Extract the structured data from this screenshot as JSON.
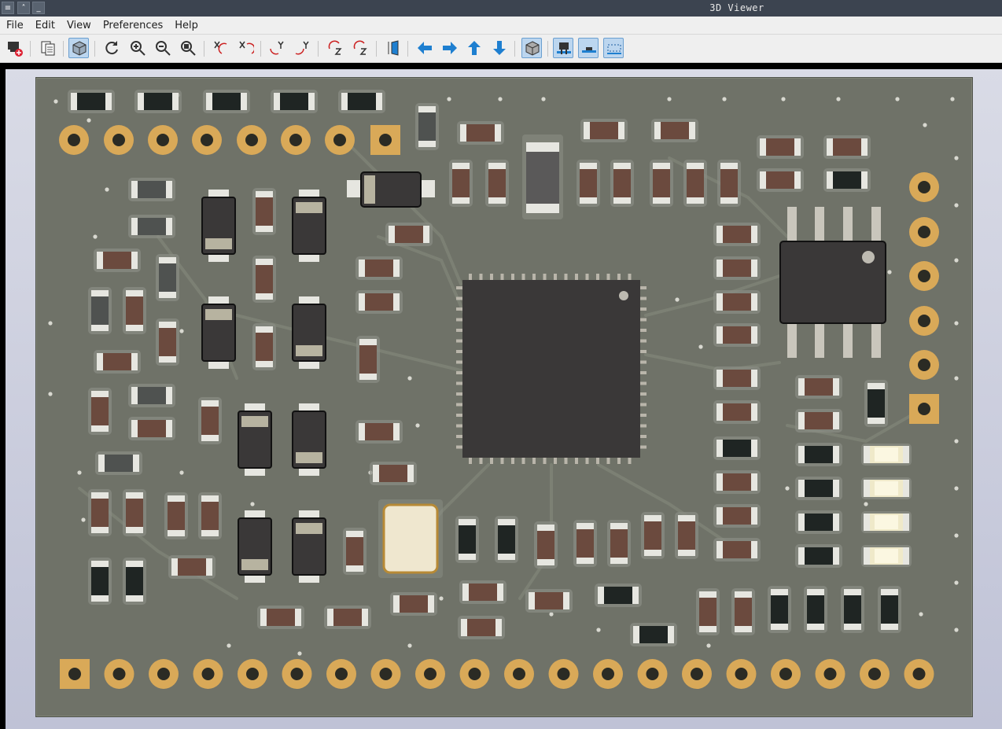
{
  "window": {
    "title": "3D Viewer"
  },
  "menu": [
    "File",
    "Edit",
    "View",
    "Preferences",
    "Help"
  ],
  "toolbar": [
    {
      "name": "export-icon",
      "tip": "Export"
    },
    {
      "name": "copy-icon",
      "tip": "Copy"
    },
    {
      "name": "view-3d-icon",
      "tip": "3D view",
      "active": true
    },
    {
      "name": "refresh-icon",
      "tip": "Reload"
    },
    {
      "name": "zoom-in-icon",
      "tip": "Zoom in"
    },
    {
      "name": "zoom-out-icon",
      "tip": "Zoom out"
    },
    {
      "name": "zoom-fit-icon",
      "tip": "Zoom to fit"
    },
    {
      "name": "rotate-x-cw-icon",
      "tip": "Rotate X clockwise"
    },
    {
      "name": "rotate-x-ccw-icon",
      "tip": "Rotate X counterclockwise"
    },
    {
      "name": "rotate-y-cw-icon",
      "tip": "Rotate Y clockwise"
    },
    {
      "name": "rotate-y-ccw-icon",
      "tip": "Rotate Y counterclockwise"
    },
    {
      "name": "rotate-z-cw-icon",
      "tip": "Rotate Z clockwise"
    },
    {
      "name": "rotate-z-ccw-icon",
      "tip": "Rotate Z counterclockwise"
    },
    {
      "name": "flip-board-icon",
      "tip": "Flip board"
    },
    {
      "name": "pan-left-icon",
      "tip": "Pan left"
    },
    {
      "name": "pan-right-icon",
      "tip": "Pan right"
    },
    {
      "name": "pan-up-icon",
      "tip": "Pan up"
    },
    {
      "name": "pan-down-icon",
      "tip": "Pan down"
    },
    {
      "name": "orthographic-icon",
      "tip": "Orthographic",
      "active": true
    },
    {
      "name": "show-tht-icon",
      "tip": "Through hole",
      "active": true
    },
    {
      "name": "show-smd-icon",
      "tip": "SMD",
      "active": true
    },
    {
      "name": "show-virtual-icon",
      "tip": "Virtual",
      "active": true
    }
  ],
  "titlebar_icons": [
    "app-menu-icon",
    "maximize-icon",
    "minimize-icon"
  ],
  "colors": {
    "board": "#6f7268",
    "pad_gold": "#d9a958",
    "ic_body": "#3a3838",
    "resistor_body": "#6b4a3e",
    "terminal": "#e6e6e0"
  }
}
